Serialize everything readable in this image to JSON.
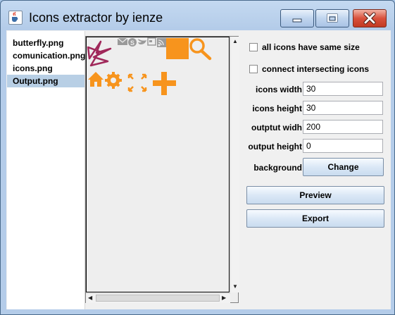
{
  "window": {
    "title": "Icons extractor by ienze",
    "app_icon": "java-cup-icon",
    "controls": {
      "minimize_icon": "minimize-icon",
      "maximize_icon": "maximize-icon",
      "close_icon": "close-icon"
    }
  },
  "file_list": {
    "items": [
      {
        "label": "butterfly.png"
      },
      {
        "label": "comunication.png"
      },
      {
        "label": "icons.png"
      },
      {
        "label": "Output.png",
        "selected": true
      }
    ]
  },
  "preview": {
    "icons": [
      "butterfly-icon",
      "mail-icon",
      "skype-icon",
      "twitter-icon",
      "card-icon",
      "rss-icon",
      "square-icon",
      "search-icon",
      "home-icon",
      "gear-icon",
      "fullscreen-icon",
      "plus-icon"
    ],
    "accent_color": "#f7941d",
    "butterfly_color": "#a0285a",
    "gray_icon_color": "#9a9a9a"
  },
  "options": {
    "same_size_label": "all icons have same size",
    "same_size_checked": false,
    "connect_label": "connect intersecting icons",
    "connect_checked": false
  },
  "fields": {
    "icons_width": {
      "label": "icons width",
      "value": "30"
    },
    "icons_height": {
      "label": "icons height",
      "value": "30"
    },
    "output_width": {
      "label": "outptut widh",
      "value": "200"
    },
    "output_height": {
      "label": "output height",
      "value": "0"
    }
  },
  "background": {
    "label": "background",
    "button": "Change"
  },
  "actions": {
    "preview": "Preview",
    "export": "Export"
  }
}
